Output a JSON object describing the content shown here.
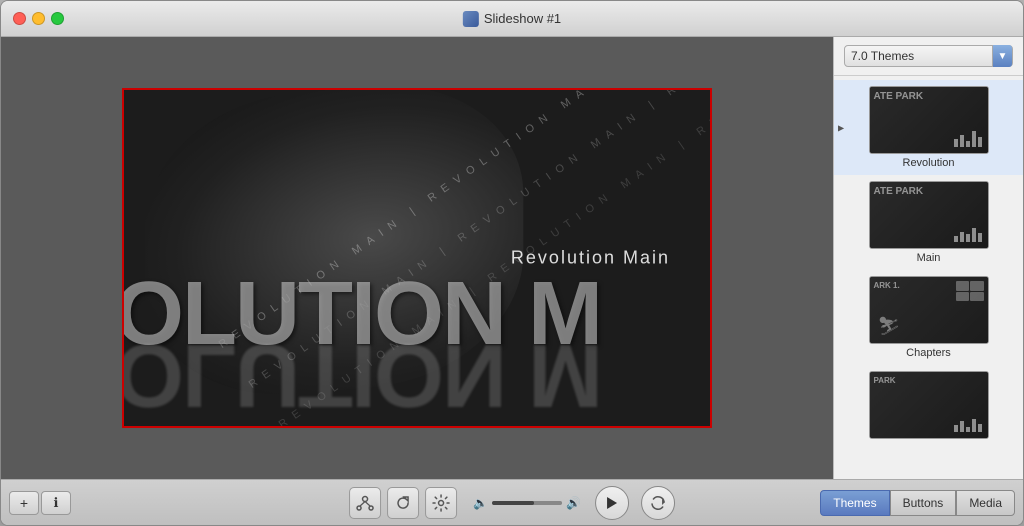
{
  "window": {
    "title": "Slideshow #1",
    "traffic_lights": [
      "close",
      "minimize",
      "maximize"
    ]
  },
  "preview": {
    "center_title": "Revolution Main",
    "big_text": "OLUTION M",
    "diag_lines": [
      "REVOLUTION MAIN | REVOLUTION MAIN",
      "REVOLUTION MAIN | REVOLUTION MAIN",
      "REVOLUTION MAIN | REVOLUTION MAIN"
    ]
  },
  "themes_panel": {
    "dropdown_label": "7.0 Themes",
    "items": [
      {
        "id": "revolution",
        "label": "Revolution",
        "selected": true
      },
      {
        "id": "main",
        "label": "Main",
        "selected": false
      },
      {
        "id": "chapters",
        "label": "Chapters",
        "selected": false
      },
      {
        "id": "extra",
        "label": "",
        "selected": false
      }
    ]
  },
  "toolbar": {
    "add_label": "+",
    "info_label": "ℹ",
    "volume_icon": "🔈",
    "volume_icon_right": "🔊",
    "tabs": [
      {
        "id": "themes",
        "label": "Themes",
        "active": true
      },
      {
        "id": "buttons",
        "label": "Buttons",
        "active": false
      },
      {
        "id": "media",
        "label": "Media",
        "active": false
      }
    ]
  }
}
